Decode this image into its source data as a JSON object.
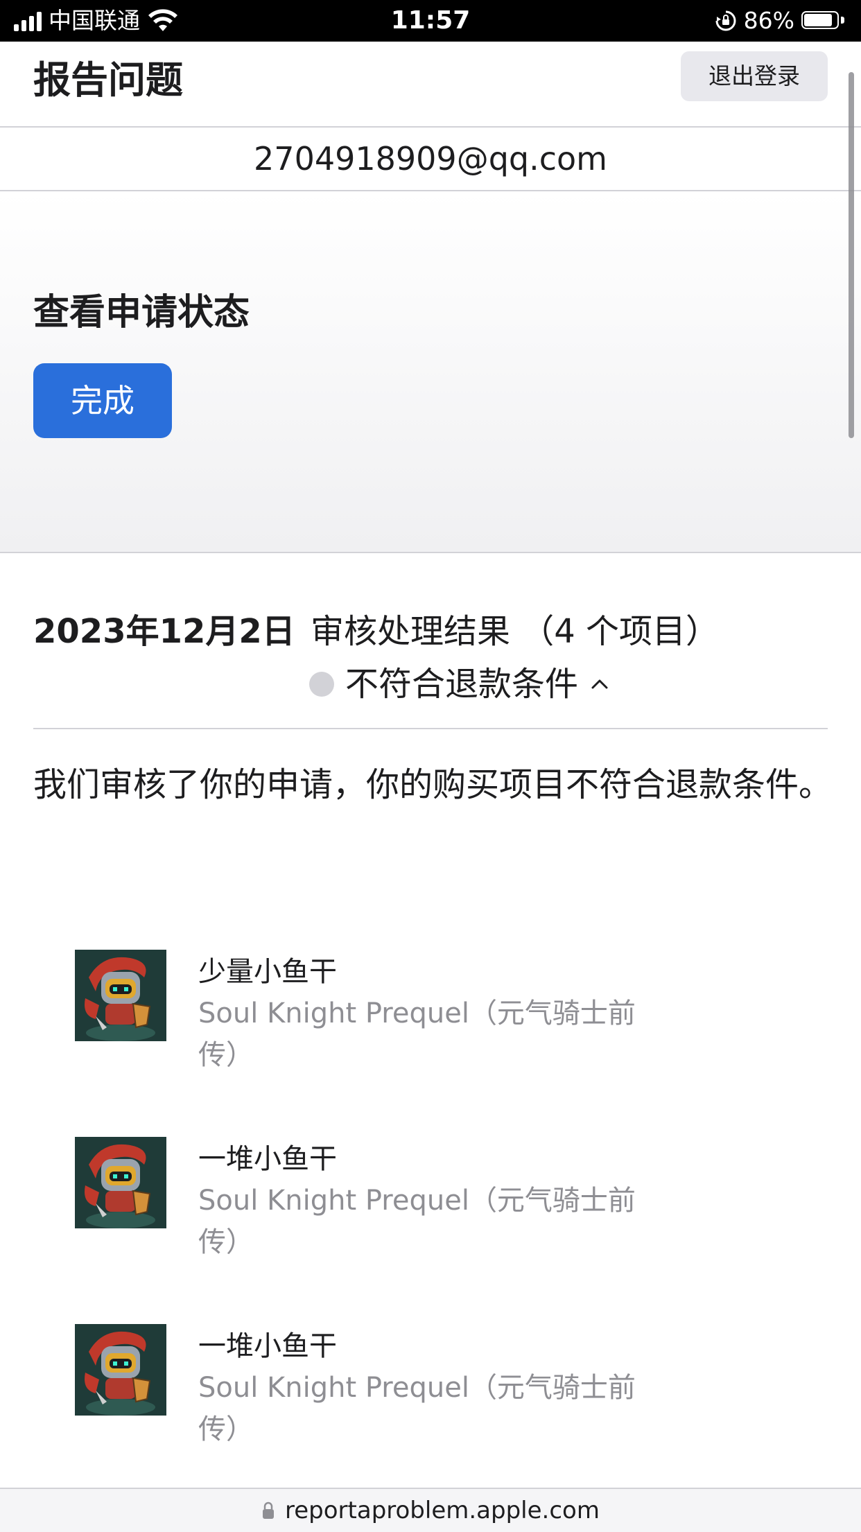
{
  "status_bar": {
    "carrier": "中国联通",
    "time": "11:57",
    "battery_percent": "86%",
    "battery_level": 0.86,
    "icons": [
      "signal-icon",
      "wifi-icon",
      "orientation-lock-icon",
      "battery-icon"
    ]
  },
  "header": {
    "title": "报告问题",
    "signout_label": "退出登录"
  },
  "account": {
    "email": "2704918909@qq.com"
  },
  "hero": {
    "title": "查看申请状态",
    "done_label": "完成"
  },
  "result": {
    "date": "2023年12月2日",
    "title": "审核处理结果 （4 个项目）",
    "status": "不符合退款条件",
    "message": "我们审核了你的申请，你的购买项目不符合退款条件。"
  },
  "items": [
    {
      "name": "少量小鱼干",
      "app": "Soul Knight Prequel（元气骑士前传）"
    },
    {
      "name": "一堆小鱼干",
      "app": "Soul Knight Prequel（元气骑士前传）"
    },
    {
      "name": "一堆小鱼干",
      "app": "Soul Knight Prequel（元气骑士前传）"
    }
  ],
  "browser": {
    "url": "reportaproblem.apple.com"
  },
  "colors": {
    "accent": "#2a6fdb",
    "status_dot": "#d2d2d7",
    "secondary_text": "#8e8e93"
  }
}
